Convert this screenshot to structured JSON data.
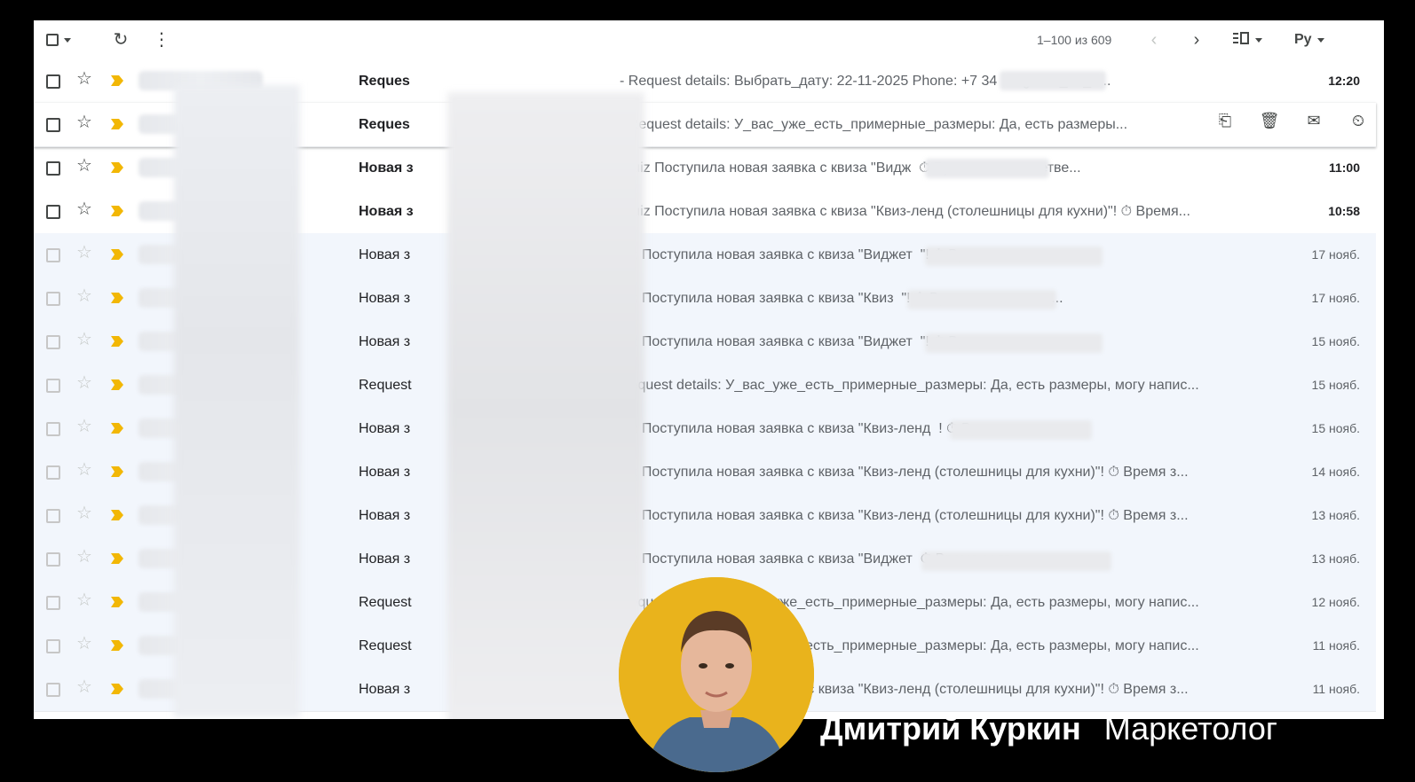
{
  "toolbar": {
    "pager_text": "1–100 из 609",
    "lang_label": "Ру",
    "icons": [
      "select-all-checkbox",
      "refresh-icon",
      "more-vert-icon",
      "chevron-left-icon",
      "chevron-right-icon",
      "density-icon",
      "input-language-icon"
    ]
  },
  "emails": [
    {
      "subject": "Reques",
      "snippet": "- Request details: Выбрать_дату: 22-11-2025 Phone: +7 ‏‏‏‏‏‏‏‏‏‏‏‏‏‏‏‏‏‏‏‏‏‏‏‏‏‏‏‏‏‏‏‏‏‏‏‏‏‏‏‏‏‏‏‏‏‏‏‏‏‏‏‏‏‏ 34 Soglasie_na_o...",
      "date": "12:20",
      "unread": true
    },
    {
      "subject": "Reques",
      "snippet": "- Request details: У_вас_уже_есть_примерные_размеры: Да, есть размеры...",
      "date": "",
      "unread": true,
      "hovered": true
    },
    {
      "subject": "Новая з",
      "snippet": "rquiz Поступила новая заявка с квиза \"Видж ‏‏‏‏‏‏‏‏‏‏‏‏‏‏‏‏‏‏‏‏‏‏‏‏‏‏‏‏‏‏‏‏‏‏‏‏ ⏱ Время заявки: четве...",
      "date": "11:00",
      "unread": true
    },
    {
      "subject": "Новая з",
      "snippet": "rquiz Поступила новая заявка с квиза \"Квиз-ленд (столешницы для кухни)\"! ⏱ Время...",
      "date": "10:58",
      "unread": true
    },
    {
      "subject": "Новая з",
      "snippet": "uiz Поступила новая заявка с квиза \"Виджет ‏‏‏‏‏‏‏‏‏‏‏‏‏‏‏‏‏‏‏‏‏‏‏‏‏‏‏‏‏‏‏‏‏‏‏‏‏‏‏‏‏‏‏‏‏‏‏‏‏‏‏‏ \"! ⏱ Время заяв...",
      "date": "17 нояб.",
      "unread": false
    },
    {
      "subject": "Новая з",
      "snippet": "uiz Поступила новая заявка с квиза \"Квиз ‏‏‏‏‏‏‏‏‏‏‏‏‏‏‏‏‏‏‏‏‏‏‏‏‏‏‏‏‏‏‏‏‏‏‏‏‏‏‏‏‏‏‏‏ \"! ⏱ Время заявки: пон...",
      "date": "17 нояб.",
      "unread": false
    },
    {
      "subject": "Новая з",
      "snippet": "uiz Поступила новая заявка с квиза \"Виджет ‏‏‏‏‏‏‏‏‏‏‏‏‏‏‏‏‏‏‏‏‏‏‏‏‏‏‏‏‏‏‏‏‏‏‏‏‏‏‏‏‏‏‏‏‏‏‏‏‏‏‏‏ \"! ⏱ Время заяв...",
      "date": "15 нояб.",
      "unread": false
    },
    {
      "subject": "Request",
      "snippet": "Request details: У_вас_уже_есть_примерные_размеры: Да, есть размеры, могу напис...",
      "date": "15 нояб.",
      "unread": false
    },
    {
      "subject": "Новая з",
      "snippet": "uiz Поступила новая заявка с квиза \"Квиз-ленд ‏‏‏‏‏‏‏‏‏‏‏‏‏‏‏‏‏‏‏‏‏‏‏‏‏‏‏‏‏‏‏‏‏‏‏‏‏‏‏‏‏‏ ! ⏱ Время заявки:...",
      "date": "15 нояб.",
      "unread": false
    },
    {
      "subject": "Новая з",
      "snippet": "uiz Поступила новая заявка с квиза \"Квиз-ленд (столешницы для кухни)\"! ⏱ Время з...",
      "date": "14 нояб.",
      "unread": false
    },
    {
      "subject": "Новая з",
      "snippet": "uiz Поступила новая заявка с квиза \"Квиз-ленд (столешницы для кухни)\"! ⏱ Время з...",
      "date": "13 нояб.",
      "unread": false
    },
    {
      "subject": "Новая з",
      "snippet": "uiz Поступила новая заявка с квиза \"Виджет ‏‏‏‏‏‏‏‏‏‏‏‏‏‏‏‏‏‏‏‏‏‏‏‏‏‏‏‏‏‏‏‏‏‏‏‏‏‏‏‏‏‏‏‏‏‏‏‏‏‏‏‏‏‏ ⏱ Время заяв...",
      "date": "13 нояб.",
      "unread": false
    },
    {
      "subject": "Request",
      "snippet": "Request details: У_вас_уже_есть_примерные_размеры: Да, есть размеры, могу напис...",
      "date": "12 нояб.",
      "unread": false
    },
    {
      "subject": "Request",
      "snippet": "Request details: У_вас_уже_есть_примерные_размеры: Да, есть размеры, могу напис...",
      "date": "11 нояб.",
      "unread": false
    },
    {
      "subject": "Новая з",
      "snippet": "uiz Поступила новая заявка с квиза \"Квиз-ленд (столешницы для кухни)\"! ⏱ Время з...",
      "date": "11 нояб.",
      "unread": false
    }
  ],
  "caption": {
    "name": "Дмитрий Куркин",
    "role": "Маркетолог"
  },
  "colors": {
    "important_marker": "#f2b705",
    "avatar_bg": "#e9b31c",
    "read_row_bg": "#f2f6fc"
  }
}
